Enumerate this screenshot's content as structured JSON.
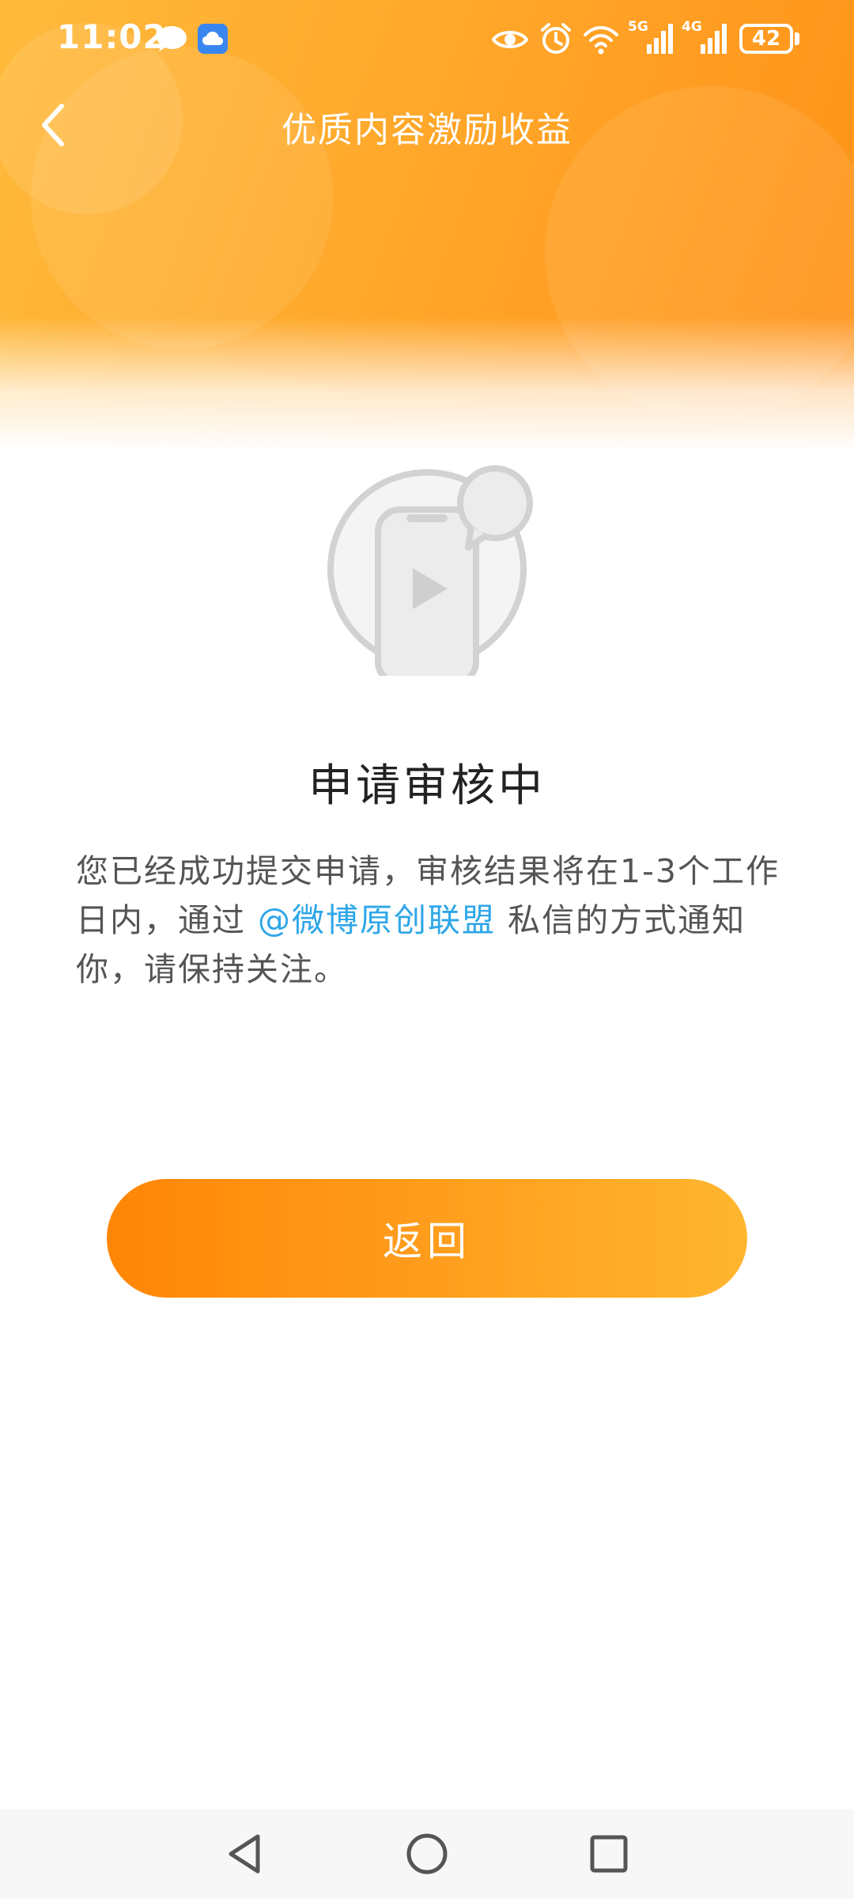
{
  "status_bar": {
    "time": "11:02",
    "battery_level": "42",
    "icons": [
      "chat-bubble-icon",
      "cloud-app-icon",
      "eye-icon",
      "alarm-icon",
      "wifi-icon",
      "signal-5g-icon",
      "signal-4g-icon",
      "battery-icon"
    ],
    "signal_labels": [
      "5G",
      "4G"
    ]
  },
  "nav": {
    "back_icon": "chevron-left-icon",
    "title": "优质内容激励收益"
  },
  "main": {
    "illustration_icon": "phone-video-chat-icon",
    "status_title": "申请审核中",
    "description_before": "您已经成功提交申请，审核结果将在1-3个工作日内，通过 ",
    "mention": "@微博原创联盟",
    "description_after": " 私信的方式通知你，请保持关注。",
    "return_label": "返回"
  },
  "system_nav": {
    "back_icon": "triangle-back-icon",
    "home_icon": "circle-home-icon",
    "recents_icon": "square-recents-icon"
  },
  "colors": {
    "header_start": "#ffba3b",
    "header_end": "#ff9117",
    "button_start": "#ff8606",
    "button_end": "#ffb62f",
    "link": "#2ea6e8",
    "title_text": "#222222",
    "body_text": "#555555"
  }
}
